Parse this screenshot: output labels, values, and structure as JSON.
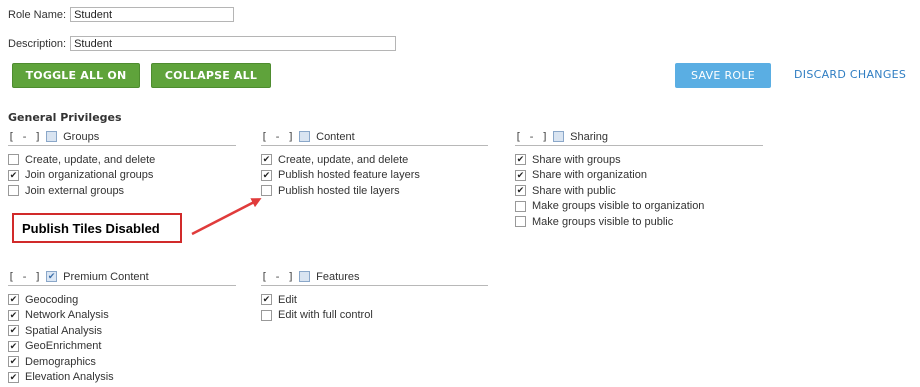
{
  "form": {
    "role_name_label": "Role Name:",
    "role_name_value": "Student",
    "description_label": "Description:",
    "description_value": "Student"
  },
  "buttons": {
    "toggle_all_on": "TOGGLE ALL ON",
    "collapse_all": "COLLAPSE ALL",
    "save_role": "SAVE ROLE",
    "discard_changes": "DISCARD CHANGES"
  },
  "general_privileges_title": "General Privileges",
  "toggle_glyph": "[ - ]",
  "groups": {
    "groups": {
      "title": "Groups",
      "header_checked": false,
      "items": [
        {
          "label": "Create, update, and delete",
          "checked": false
        },
        {
          "label": "Join organizational groups",
          "checked": true
        },
        {
          "label": "Join external groups",
          "checked": false
        }
      ]
    },
    "content": {
      "title": "Content",
      "header_checked": false,
      "items": [
        {
          "label": "Create, update, and delete",
          "checked": true
        },
        {
          "label": "Publish hosted feature layers",
          "checked": true
        },
        {
          "label": "Publish hosted tile layers",
          "checked": false
        }
      ]
    },
    "sharing": {
      "title": "Sharing",
      "header_checked": false,
      "items": [
        {
          "label": "Share with groups",
          "checked": true
        },
        {
          "label": "Share with organization",
          "checked": true
        },
        {
          "label": "Share with public",
          "checked": true
        },
        {
          "label": "Make groups visible to organization",
          "checked": false
        },
        {
          "label": "Make groups visible to public",
          "checked": false
        }
      ]
    },
    "premium": {
      "title": "Premium Content",
      "header_checked": true,
      "items": [
        {
          "label": "Geocoding",
          "checked": true
        },
        {
          "label": "Network Analysis",
          "checked": true
        },
        {
          "label": "Spatial Analysis",
          "checked": true
        },
        {
          "label": "GeoEnrichment",
          "checked": true
        },
        {
          "label": "Demographics",
          "checked": true
        },
        {
          "label": "Elevation Analysis",
          "checked": true
        }
      ]
    },
    "features": {
      "title": "Features",
      "header_checked": false,
      "items": [
        {
          "label": "Edit",
          "checked": true
        },
        {
          "label": "Edit with full control",
          "checked": false
        }
      ]
    }
  },
  "callout_text": "Publish Tiles Disabled",
  "colors": {
    "green_button": "#5fa33b",
    "blue_button": "#5aaee3",
    "link": "#2f7dc2",
    "callout_border": "#d12a2a"
  }
}
